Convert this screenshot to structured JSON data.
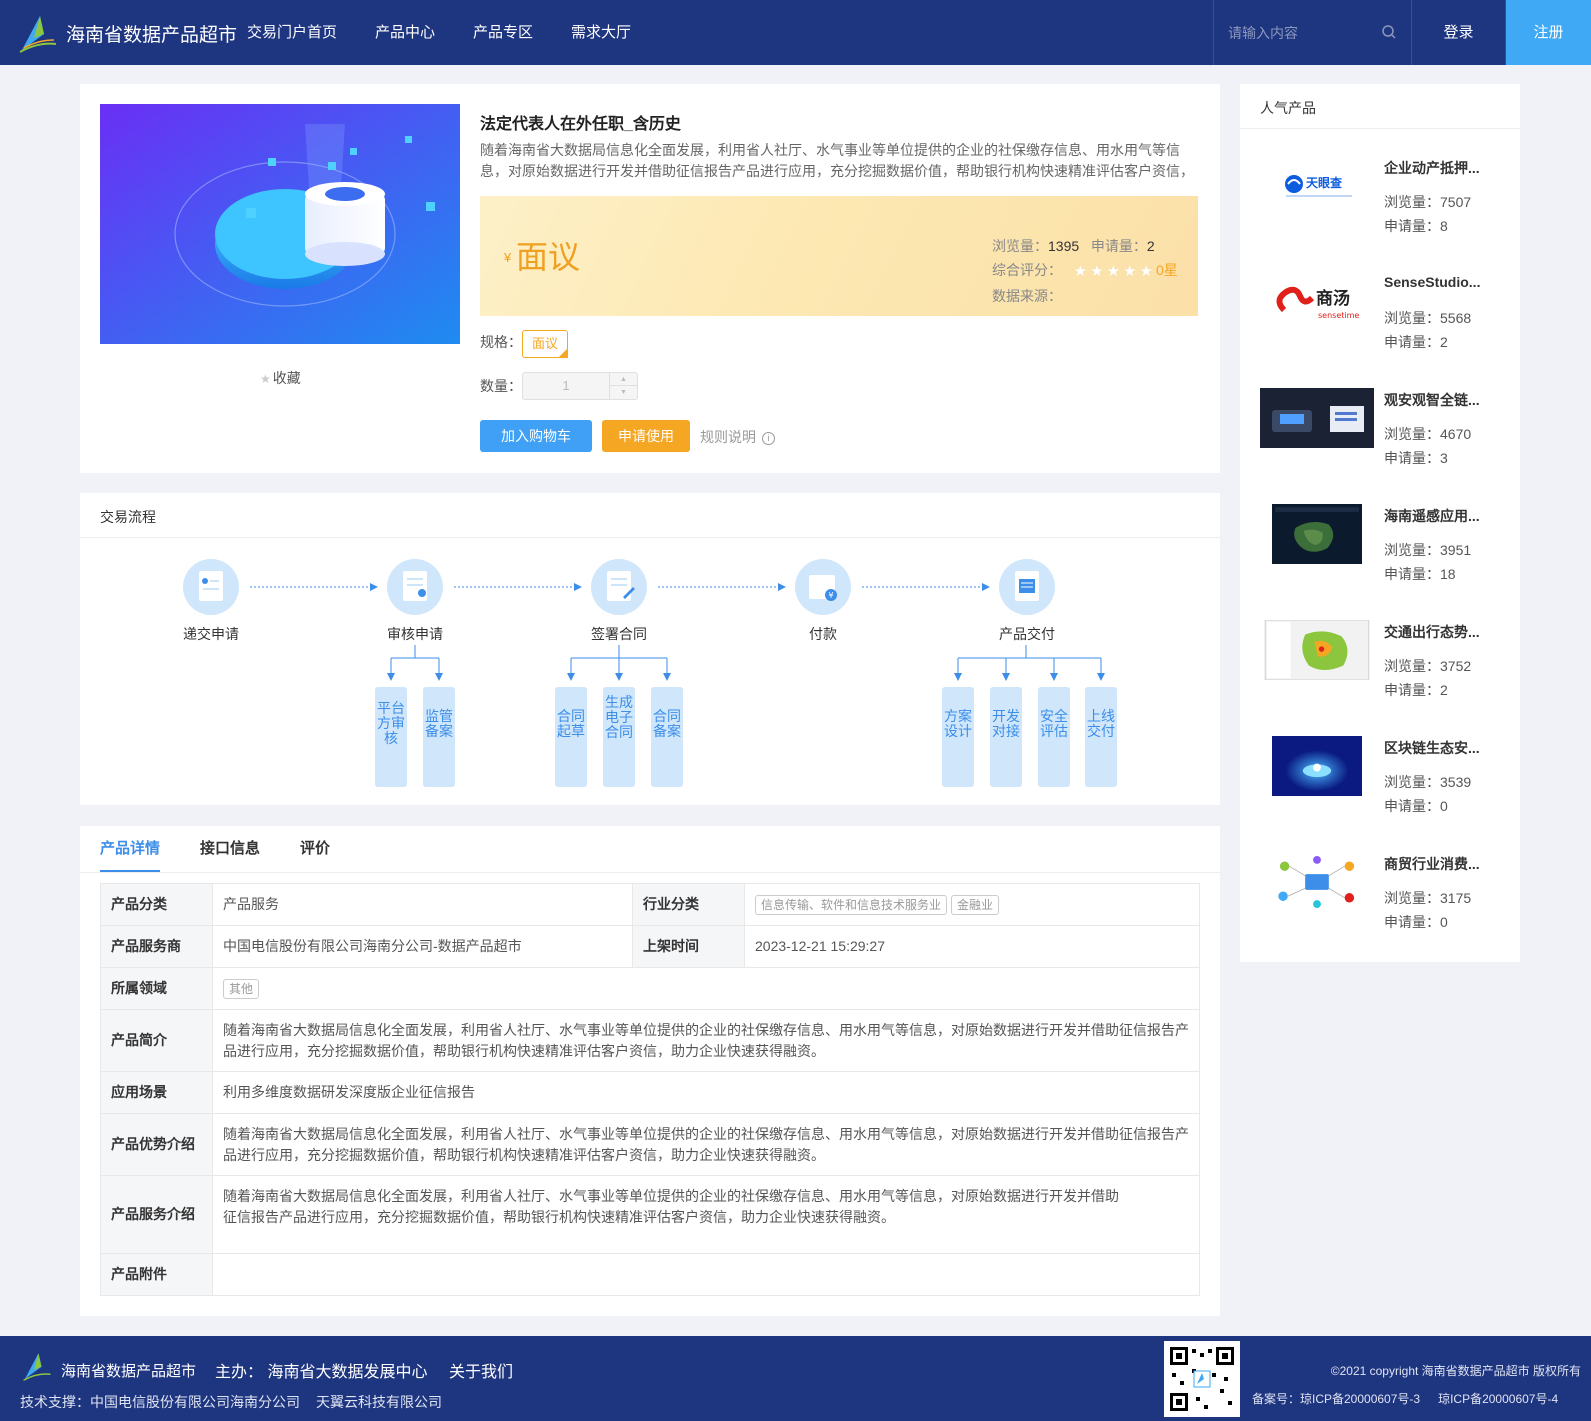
{
  "header": {
    "site_name": "海南省数据产品超市",
    "nav": [
      "交易门户首页",
      "产品中心",
      "产品专区",
      "需求大厅"
    ],
    "search_placeholder": "请输入内容",
    "login": "登录",
    "register": "注册",
    "bg_color": "#1e3580",
    "register_color": "#3fa9f5"
  },
  "product": {
    "title": "法定代表人在外任职_含历史",
    "description": "随着海南省大数据局信息化全面发展，利用省人社厅、水气事业等单位提供的企业的社保缴存信息、用水用气等信息，对原始数据进行开发并借助征信报告产品进行应用，充分挖掘数据价值，帮助银行机构快速精准评估客户资信，助力企业快速获得融资。",
    "favorite": "收藏",
    "currency": "¥",
    "price": "面议",
    "views_label": "浏览量：",
    "views": "1395",
    "applies_label": "申请量：",
    "applies": "2",
    "rating_label": "综合评分：",
    "rating_stars": 0,
    "rating_text": "0星",
    "source_label": "数据来源：",
    "spec_label": "规格：",
    "spec_value": "面议",
    "qty_label": "数量：",
    "qty_value": "1",
    "add_cart": "加入购物车",
    "apply": "申请使用",
    "rules": "规则说明",
    "price_color": "#f0a020"
  },
  "flow": {
    "title": "交易流程",
    "steps": [
      "递交申请",
      "审核申请",
      "签署合同",
      "付款",
      "产品交付"
    ],
    "sub_audit": [
      "平台方审核",
      "监管备案"
    ],
    "sub_contract": [
      "合同起草",
      "生成电子合同",
      "合同备案"
    ],
    "sub_delivery": [
      "方案设计",
      "开发对接",
      "安全评估",
      "上线交付"
    ]
  },
  "detail": {
    "tabs": [
      "产品详情",
      "接口信息",
      "评价"
    ],
    "category_label": "产品分类",
    "category": "产品服务",
    "industry_label": "行业分类",
    "industry_tags": [
      "信息传输、软件和信息技术服务业",
      "金融业"
    ],
    "provider_label": "产品服务商",
    "provider": "中国电信股份有限公司海南分公司-数据产品超市",
    "listed_label": "上架时间",
    "listed": "2023-12-21 15:29:27",
    "domain_label": "所属领域",
    "domain_tag": "其他",
    "intro_label": "产品简介",
    "intro": "随着海南省大数据局信息化全面发展，利用省人社厅、水气事业等单位提供的企业的社保缴存信息、用水用气等信息，对原始数据进行开发并借助征信报告产品进行应用，充分挖掘数据价值，帮助银行机构快速精准评估客户资信，助力企业快速获得融资。",
    "scene_label": "应用场景",
    "scene": "利用多维度数据研发深度版企业征信报告",
    "advantage_label": "产品优势介绍",
    "advantage": "随着海南省大数据局信息化全面发展，利用省人社厅、水气事业等单位提供的企业的社保缴存信息、用水用气等信息，对原始数据进行开发并借助征信报告产品进行应用，充分挖掘数据价值，帮助银行机构快速精准评估客户资信，助力企业快速获得融资。",
    "service_label": "产品服务介绍",
    "service_line1": "随着海南省大数据局信息化全面发展，利用省人社厅、水气事业等单位提供的企业的社保缴存信息、用水用气等信息，对原始数据进行开发并借助",
    "service_line2": "征信报告产品进行应用，充分挖掘数据价值，帮助银行机构快速精准评估客户资信，助力企业快速获得融资。",
    "attachment_label": "产品附件"
  },
  "hot": {
    "title": "人气产品",
    "views_label": "浏览量：",
    "applies_label": "申请量：",
    "items": [
      {
        "name": "企业动产抵押...",
        "views": "7507",
        "applies": "8",
        "logo_text": "天眼查"
      },
      {
        "name": "SenseStudio...",
        "views": "5568",
        "applies": "2",
        "logo_text": "商汤",
        "logo_sub": "sensetime"
      },
      {
        "name": "观安观智全链...",
        "views": "4670",
        "applies": "3"
      },
      {
        "name": "海南遥感应用...",
        "views": "3951",
        "applies": "18"
      },
      {
        "name": "交通出行态势...",
        "views": "3752",
        "applies": "2"
      },
      {
        "name": "区块链生态安...",
        "views": "3539",
        "applies": "0"
      },
      {
        "name": "商贸行业消费...",
        "views": "3175",
        "applies": "0"
      }
    ]
  },
  "footer": {
    "site_name": "海南省数据产品超市",
    "sponsor": "主办： 海南省大数据发展中心",
    "about": "关于我们",
    "tech_support": "技术支撑：中国电信股份有限公司海南分公司",
    "tech_support2": "天翼云科技有限公司",
    "copyright": "©2021 copyright 海南省数据产品超市 版权所有",
    "icp1": "备案号：琼ICP备20000607号-3",
    "icp2": "琼ICP备20000607号-4"
  }
}
